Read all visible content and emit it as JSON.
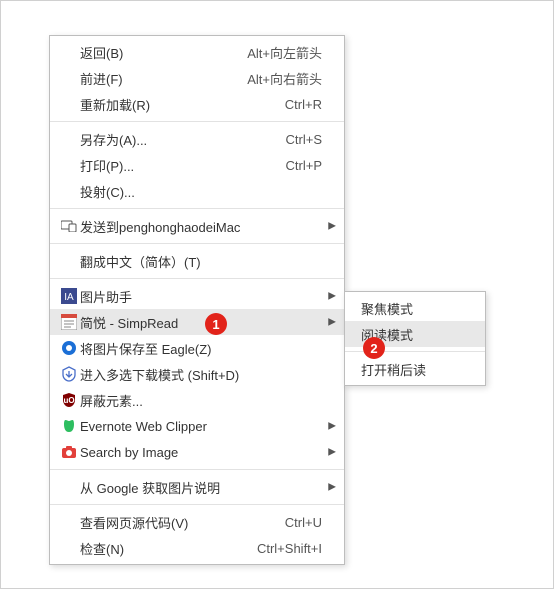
{
  "badges": {
    "b1": "1",
    "b2": "2"
  },
  "menu": {
    "back": {
      "label": "返回(B)",
      "shortcut": "Alt+向左箭头"
    },
    "forward": {
      "label": "前进(F)",
      "shortcut": "Alt+向右箭头"
    },
    "reload": {
      "label": "重新加载(R)",
      "shortcut": "Ctrl+R"
    },
    "saveas": {
      "label": "另存为(A)...",
      "shortcut": "Ctrl+S"
    },
    "print": {
      "label": "打印(P)...",
      "shortcut": "Ctrl+P"
    },
    "cast": {
      "label": "投射(C)..."
    },
    "sendto": {
      "label": "发送到penghonghaodeiMac"
    },
    "translate": {
      "label": "翻成中文（简体）(T)"
    },
    "imghelper": {
      "label": "图片助手"
    },
    "simpread": {
      "label": "简悦 - SimpRead"
    },
    "eagle": {
      "label": "将图片保存至 Eagle(Z)"
    },
    "multidl": {
      "label": "进入多选下载模式 (Shift+D)"
    },
    "ublock": {
      "label": "屏蔽元素..."
    },
    "evernote": {
      "label": "Evernote Web Clipper"
    },
    "searchimg": {
      "label": "Search by Image"
    },
    "googleimg": {
      "label": "从 Google 获取图片说明"
    },
    "viewsrc": {
      "label": "查看网页源代码(V)",
      "shortcut": "Ctrl+U"
    },
    "inspect": {
      "label": "检查(N)",
      "shortcut": "Ctrl+Shift+I"
    }
  },
  "submenu": {
    "focus": {
      "label": "聚焦模式"
    },
    "reading": {
      "label": "阅读模式"
    },
    "later": {
      "label": "打开稍后读"
    }
  }
}
